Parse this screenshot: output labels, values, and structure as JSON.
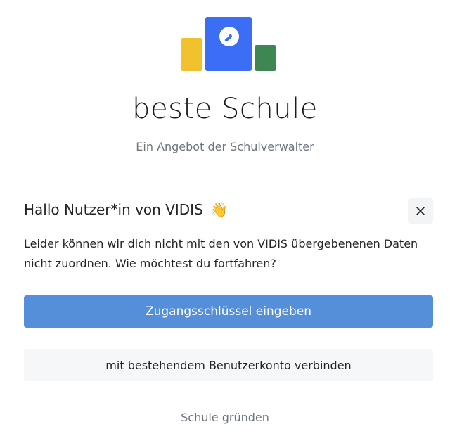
{
  "brand": {
    "title": "beste Schule",
    "subtitle": "Ein Angebot der Schulverwalter",
    "logo_colors": {
      "yellow": "#f2c12e",
      "blue": "#3c6ef5",
      "green": "#3f8752"
    }
  },
  "dialog": {
    "greeting": "Hallo Nutzer*in von VIDIS",
    "greeting_emoji": "👋",
    "close_icon": "close-icon",
    "message": "Leider können wir dich nicht mit den von VIDIS übergebenenen Daten nicht zuordnen. Wie möchtest du fortfahren?",
    "primary_button_label": "Zugangsschlüssel eingeben",
    "secondary_button_label": "mit bestehendem Benutzerkonto verbinden",
    "link_label": "Schule gründen"
  },
  "colors": {
    "primary": "#568fd9",
    "secondary_bg": "#f6f7f8",
    "muted_text": "#6c757d"
  }
}
